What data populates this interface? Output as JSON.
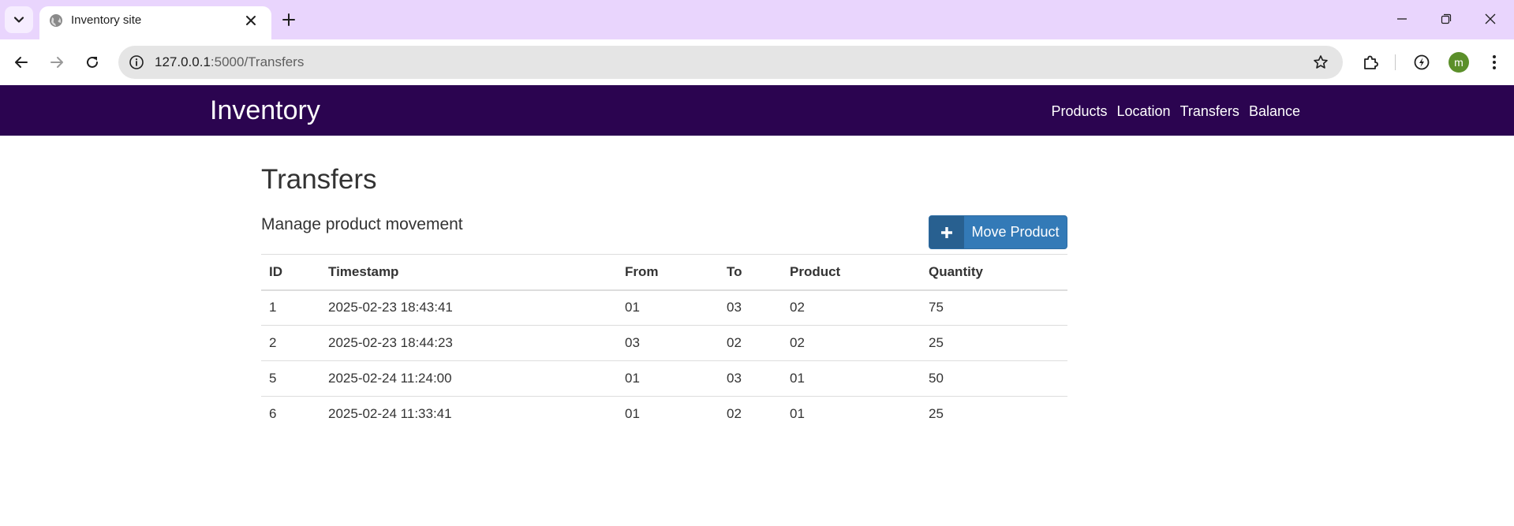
{
  "browser": {
    "tab_title": "Inventory site",
    "url_host": "127.0.0.1",
    "url_path": ":5000/Transfers",
    "avatar_initial": "m"
  },
  "site": {
    "brand": "Inventory",
    "nav": [
      "Products",
      "Location",
      "Transfers",
      "Balance"
    ]
  },
  "page": {
    "title": "Transfers",
    "subtitle": "Manage product movement",
    "move_button_label": "Move Product"
  },
  "table": {
    "headers": [
      "ID",
      "Timestamp",
      "From",
      "To",
      "Product",
      "Quantity"
    ],
    "rows": [
      [
        "1",
        "2025-02-23 18:43:41",
        "01",
        "03",
        "02",
        "75"
      ],
      [
        "2",
        "2025-02-23 18:44:23",
        "03",
        "02",
        "02",
        "25"
      ],
      [
        "5",
        "2025-02-24 11:24:00",
        "01",
        "03",
        "01",
        "50"
      ],
      [
        "6",
        "2025-02-24 11:33:41",
        "01",
        "02",
        "01",
        "25"
      ]
    ]
  },
  "colors": {
    "tabstrip": "#e9d5fd",
    "navbar": "#2b0450",
    "primary_button": "#337ab7",
    "avatar": "#5b8f2a"
  },
  "icons": {
    "tab_search": "chevron-down-icon",
    "favicon": "globe-icon",
    "tab_close": "close-icon",
    "new_tab": "plus-icon",
    "back": "arrow-left-icon",
    "forward": "arrow-right-icon",
    "reload": "reload-icon",
    "site_info": "info-icon",
    "bookmark": "star-icon",
    "extensions": "puzzle-icon",
    "performance": "performance-icon",
    "menu": "kebab-menu-icon",
    "move_button": "plus-icon"
  }
}
